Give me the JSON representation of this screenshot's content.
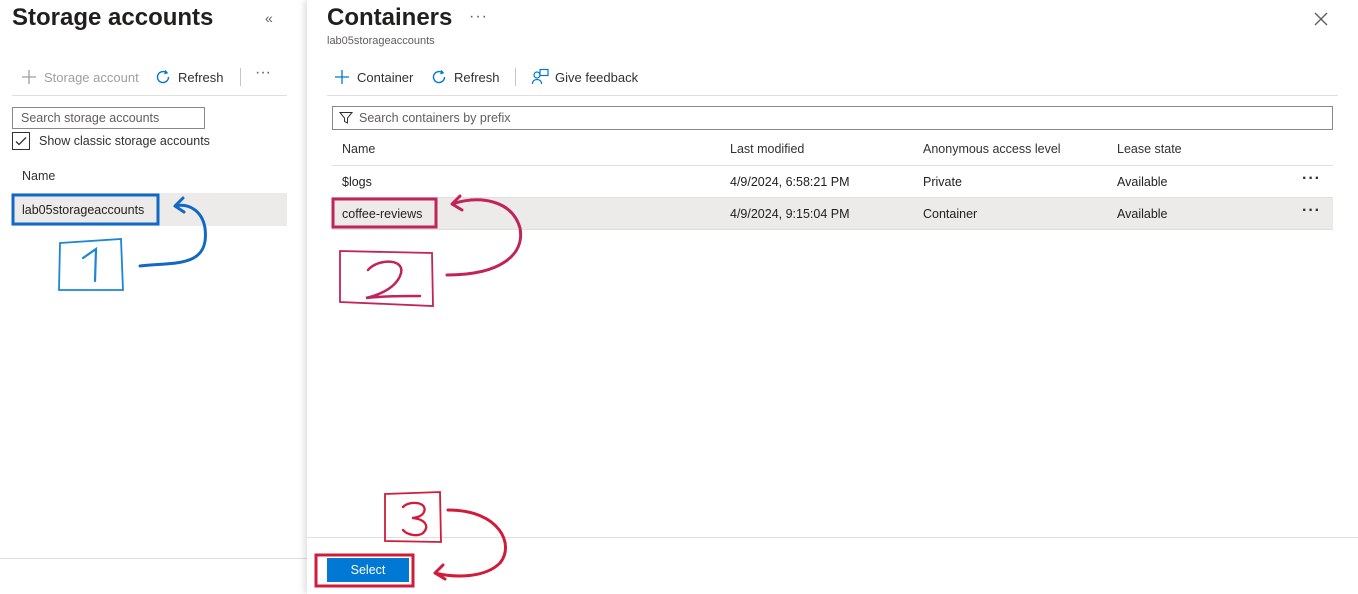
{
  "left": {
    "title": "Storage accounts",
    "collapse_icon": "double-chevron-left-icon",
    "toolbar": {
      "add_label": "Storage account",
      "refresh_label": "Refresh",
      "more_label": "···"
    },
    "search_placeholder": "Search storage accounts",
    "checkbox_label": "Show classic storage accounts",
    "column_name": "Name",
    "accounts": [
      "lab05storageaccounts"
    ]
  },
  "right": {
    "title": "Containers",
    "more_label": "···",
    "subtitle": "lab05storageaccounts",
    "toolbar": {
      "container_label": "Container",
      "refresh_label": "Refresh",
      "feedback_label": "Give feedback"
    },
    "search_placeholder": "Search containers by prefix",
    "columns": {
      "name": "Name",
      "modified": "Last modified",
      "access": "Anonymous access level",
      "lease": "Lease state"
    },
    "rows": [
      {
        "name": "$logs",
        "modified": "4/9/2024, 6:58:21 PM",
        "access": "Private",
        "lease": "Available",
        "more": "···"
      },
      {
        "name": "coffee-reviews",
        "modified": "4/9/2024, 9:15:04 PM",
        "access": "Container",
        "lease": "Available",
        "more": "···"
      }
    ],
    "select_label": "Select"
  },
  "colors": {
    "accent": "#0078d4",
    "annotation_blue": "#1168c8",
    "annotation_red": "#d01c3a",
    "selected_row": "#edebe9"
  }
}
